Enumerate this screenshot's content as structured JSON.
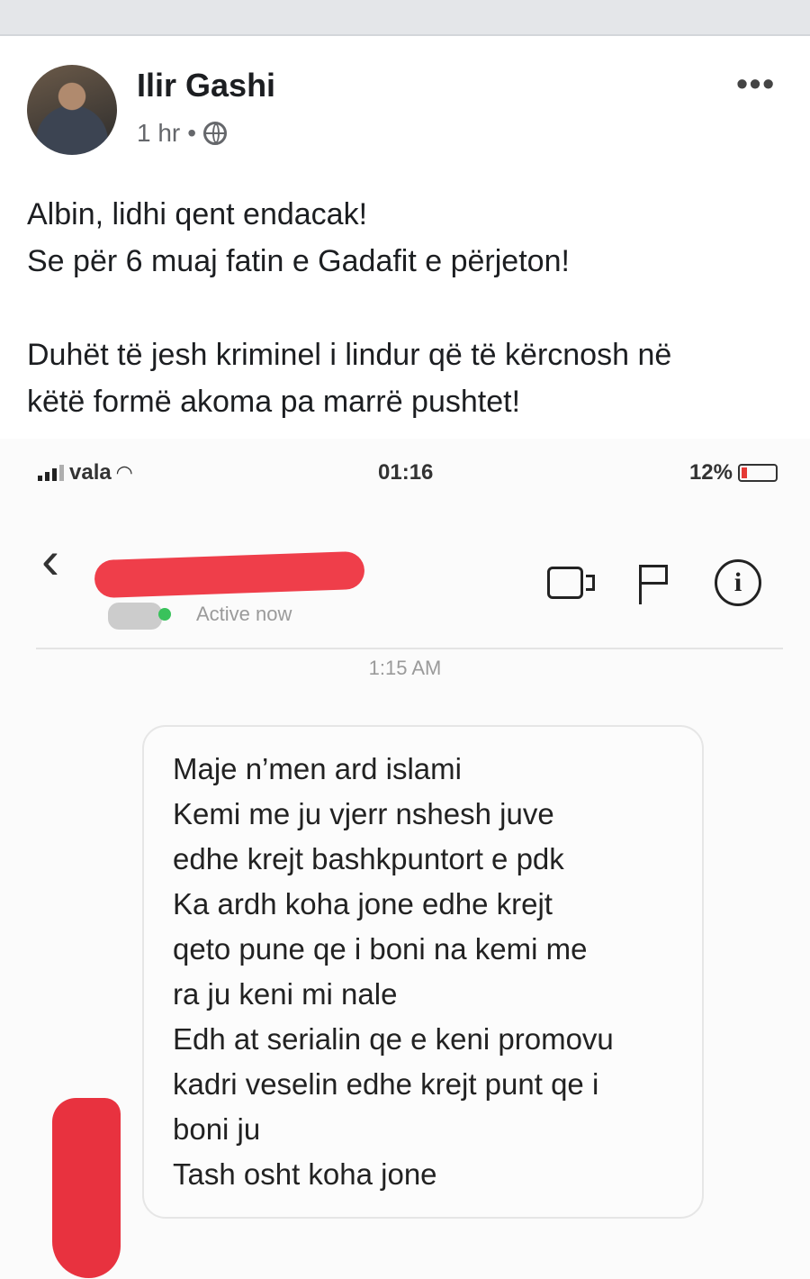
{
  "post": {
    "author": "Ilir Gashi",
    "time": "1 hr",
    "separator": "•",
    "text_lines": [
      "Albin, lidhi qent endacak!",
      "Se për 6 muaj fatin e Gadafit e përjeton!",
      "",
      "Duhët të jesh kriminel i lindur që të kërcnosh në",
      "këtë formë akoma pa marrë pushtet!"
    ],
    "more_icon": "•••"
  },
  "screenshot": {
    "carrier": "vala",
    "clock": "01:16",
    "battery": "12%",
    "back_icon": "‹",
    "active_status": "Active now",
    "info_icon": "i",
    "message_time": "1:15 AM",
    "message_lines": [
      "Maje n’men ard islami",
      "Kemi me ju vjerr nshesh juve",
      "edhe krejt bashkpuntort e pdk",
      "Ka ardh koha jone edhe krejt",
      "qeto pune qe i boni na kemi me",
      "ra ju keni mi nale",
      "Edh at serialin qe e keni promovu",
      "kadri veselin edhe krejt punt qe i",
      "boni ju",
      "Tash osht koha jone"
    ]
  }
}
